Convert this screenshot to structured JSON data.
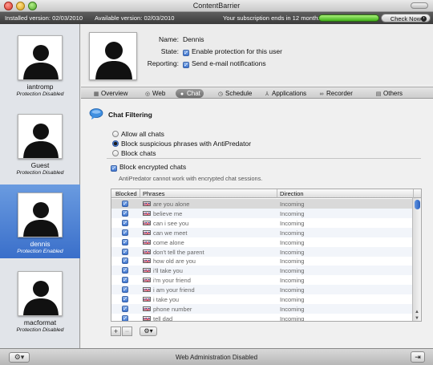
{
  "window": {
    "title": "ContentBarrier"
  },
  "infobar": {
    "installed_label": "Installed version: 02/03/2010",
    "available_label": "Available version: 02/03/2010",
    "subscription_text": "Your subscription ends in 12 months",
    "subscription_fraction": 1.0,
    "check_now_label": "Check Now",
    "colors": {
      "bar": "#4a4a4a",
      "subscription_fill": "#5bc42c"
    }
  },
  "sidebar": {
    "users": [
      {
        "name": "iantromp",
        "status": "Protection Disabled",
        "selected": false
      },
      {
        "name": "Guest",
        "status": "Protection Disabled",
        "selected": false
      },
      {
        "name": "dennis",
        "status": "Protection Enabled",
        "selected": true
      },
      {
        "name": "macformat",
        "status": "Protection Disabled",
        "selected": false
      }
    ]
  },
  "profile": {
    "name_label": "Name:",
    "name_value": "Dennis",
    "state_label": "State:",
    "state_value": "Enable protection for this user",
    "reporting_label": "Reporting:",
    "reporting_value": "Send e-mail notifications"
  },
  "tabs": [
    {
      "label": "Overview",
      "icon": "overview-icon"
    },
    {
      "label": "Web",
      "icon": "globe-icon"
    },
    {
      "label": "Chat",
      "icon": "chat-bubble-icon",
      "active": true
    },
    {
      "label": "Schedule",
      "icon": "clock-icon"
    },
    {
      "label": "Applications",
      "icon": "applications-icon"
    },
    {
      "label": "Recorder",
      "icon": "recorder-icon"
    },
    {
      "label": "Others",
      "icon": "others-icon"
    }
  ],
  "chat": {
    "section_title": "Chat Filtering",
    "options": [
      {
        "label": "Allow all chats",
        "selected": false
      },
      {
        "label": "Block suspicious phrases with AntiPredator",
        "selected": true
      },
      {
        "label": "Block chats",
        "selected": false
      }
    ],
    "block_encrypted_label": "Block encrypted chats",
    "note": "AntiPredator cannot work with encrypted chat sessions."
  },
  "phrases_table": {
    "columns": [
      "Blocked",
      "Phrases",
      "Direction"
    ],
    "rows": [
      {
        "blocked": true,
        "phrase": "are you alone",
        "direction": "Incoming"
      },
      {
        "blocked": true,
        "phrase": "believe me",
        "direction": "Incoming"
      },
      {
        "blocked": true,
        "phrase": "can i see you",
        "direction": "Incoming"
      },
      {
        "blocked": true,
        "phrase": "can we meet",
        "direction": "Incoming"
      },
      {
        "blocked": true,
        "phrase": "come alone",
        "direction": "Incoming"
      },
      {
        "blocked": true,
        "phrase": "don't tell the parent",
        "direction": "Incoming"
      },
      {
        "blocked": true,
        "phrase": "how old are you",
        "direction": "Incoming"
      },
      {
        "blocked": true,
        "phrase": "i'll take you",
        "direction": "Incoming"
      },
      {
        "blocked": true,
        "phrase": "i'm your friend",
        "direction": "Incoming"
      },
      {
        "blocked": true,
        "phrase": "i am your friend",
        "direction": "Incoming"
      },
      {
        "blocked": true,
        "phrase": "i take you",
        "direction": "Incoming"
      },
      {
        "blocked": true,
        "phrase": "phone number",
        "direction": "Incoming"
      },
      {
        "blocked": true,
        "phrase": "tell dad",
        "direction": "Incoming"
      }
    ]
  },
  "table_buttons": {
    "add": "+",
    "remove": "−"
  },
  "bottombar": {
    "status": "Web Administration Disabled"
  }
}
